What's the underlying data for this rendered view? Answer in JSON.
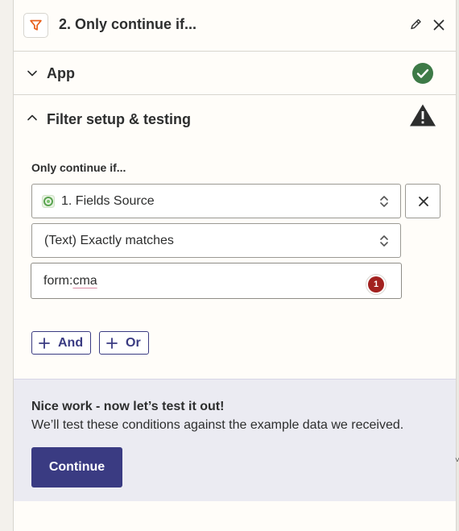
{
  "header": {
    "title": "2. Only continue if...",
    "step_icon": "filter-icon",
    "edit_icon": "pencil-icon",
    "close_icon": "close-icon"
  },
  "sections": {
    "app": {
      "label": "App",
      "status_icon": "check-circle-icon",
      "status_color": "#3d7a47"
    },
    "filter": {
      "label": "Filter setup & testing",
      "status_icon": "warning-icon"
    }
  },
  "filter": {
    "condition_label": "Only continue if...",
    "source_field": {
      "value": "1. Fields Source",
      "app_icon": "fields-source-icon"
    },
    "operator_field": {
      "value": "(Text) Exactly matches"
    },
    "value_field": {
      "value": "form:cma",
      "prefix": "form:",
      "flagged": "cma",
      "badge": "1"
    },
    "remove_icon": "close-icon",
    "and_label": "And",
    "or_label": "Or"
  },
  "test": {
    "title": "Nice work - now let’s test it out!",
    "description": "We’ll test these conditions against the example data we received.",
    "continue_label": "Continue"
  },
  "colors": {
    "accent": "#3a3b82",
    "error_badge": "#a2211f",
    "success": "#3d7a47",
    "filter_orange": "#e8601c"
  }
}
